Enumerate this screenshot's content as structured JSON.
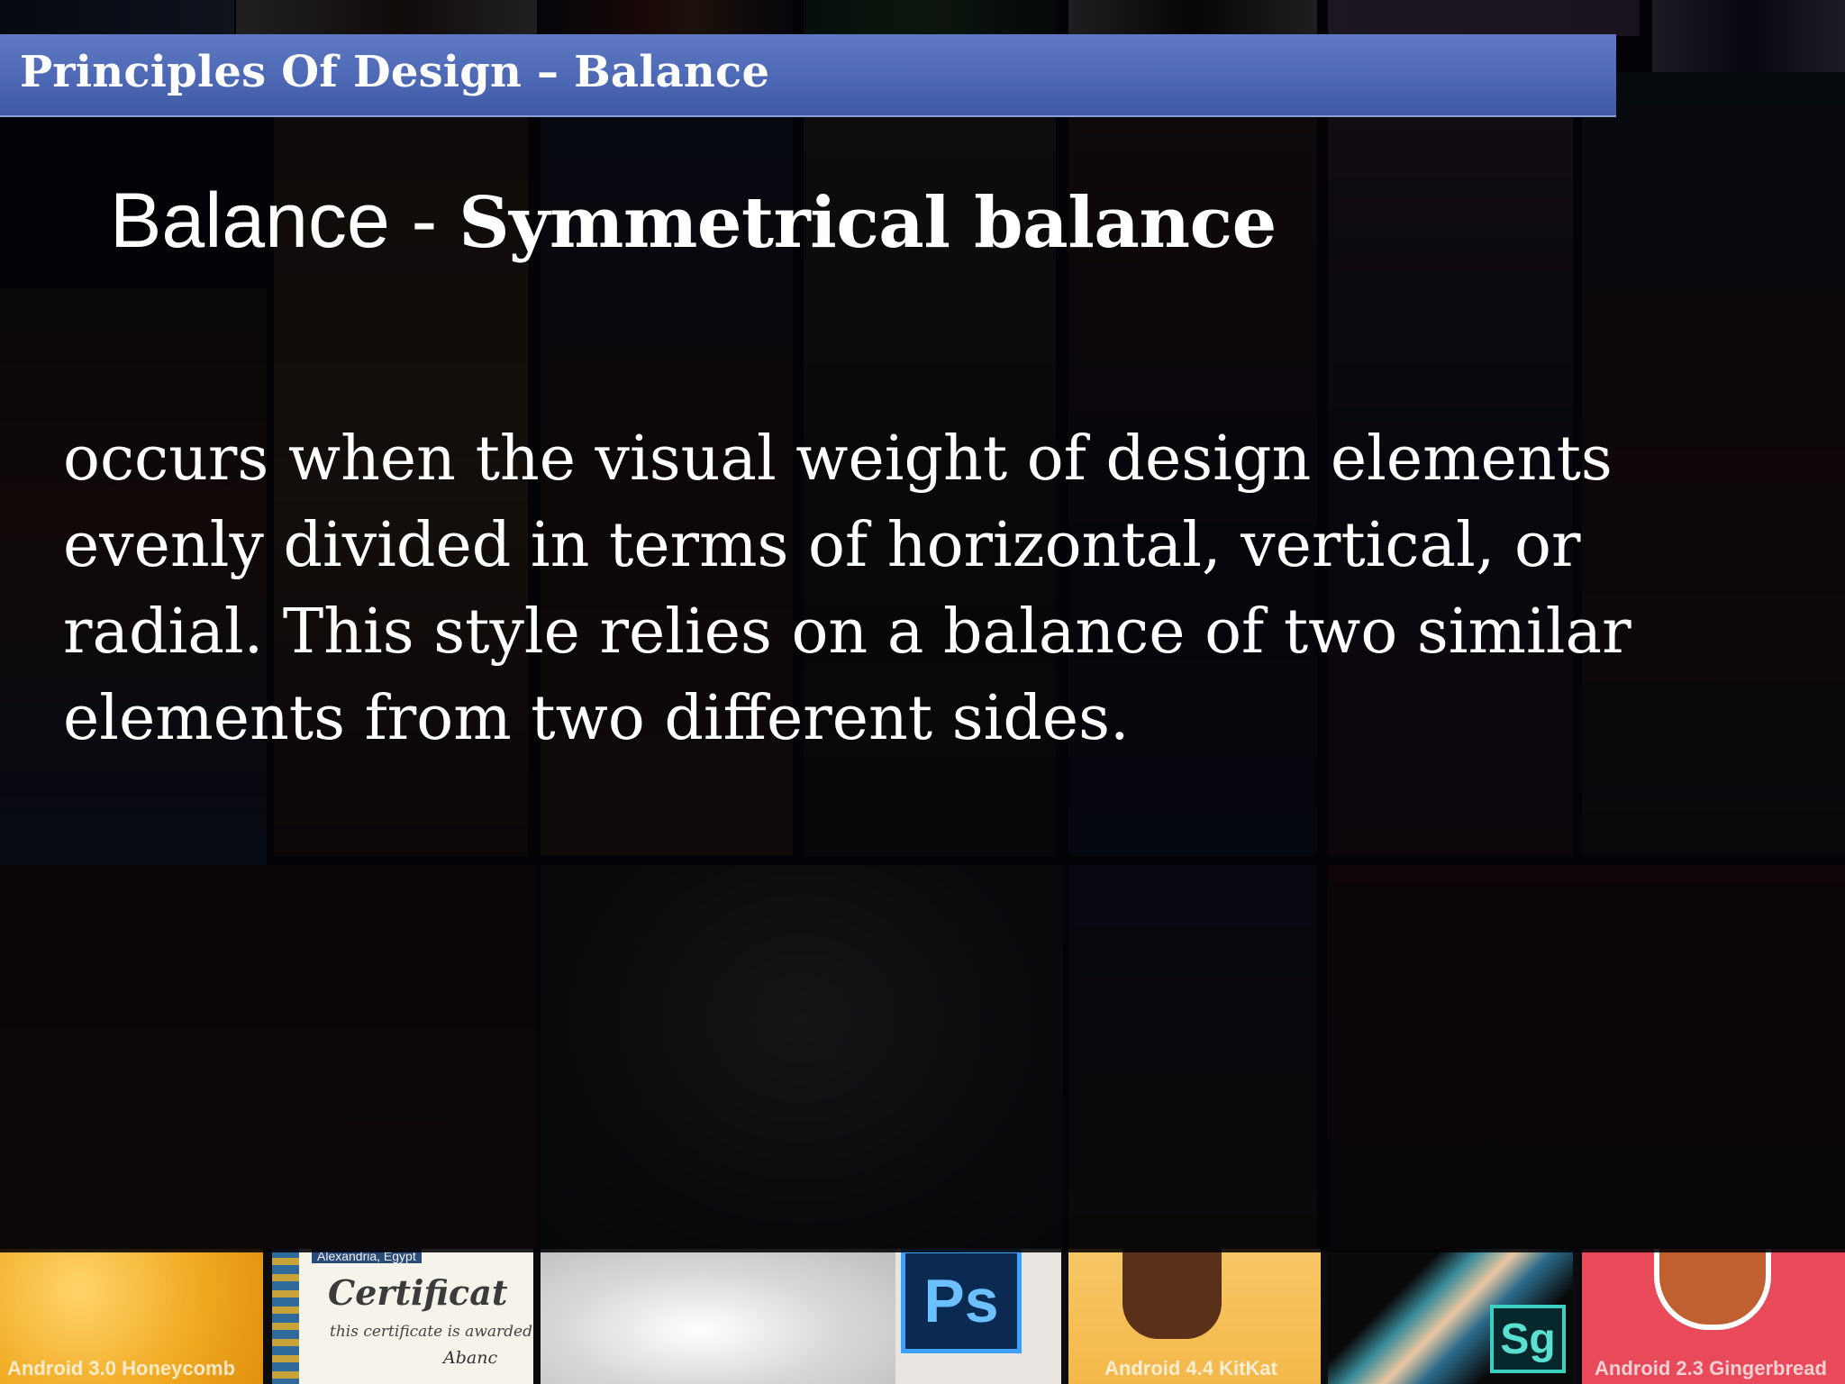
{
  "header": {
    "title": "Principles Of Design – Balance"
  },
  "slide": {
    "title_part1": "Balance - ",
    "title_part2": "Symmetrical balance",
    "body_lines": [
      "occurs when the visual weight of design elements",
      "evenly divided in terms of horizontal, vertical, or",
      "radial. This style relies on a balance of two similar",
      "elements from two different sides."
    ]
  },
  "background_tiles": {
    "honeycomb_label": "Android 3.0 Honeycomb",
    "kitkat_label": "Android 4.4 KitKat",
    "gingerbread_label": "Android 2.3 Gingerbread",
    "ps_badge": "Ps",
    "sg_badge": "Sg",
    "certificate": {
      "location": "Alexandria, Egypt",
      "title": "Certificat",
      "line": "this certificate is awarded",
      "name": "Abanc"
    }
  },
  "colors": {
    "header_bar": "#4d68b4",
    "overlay": "#020206",
    "text": "#ffffff"
  }
}
